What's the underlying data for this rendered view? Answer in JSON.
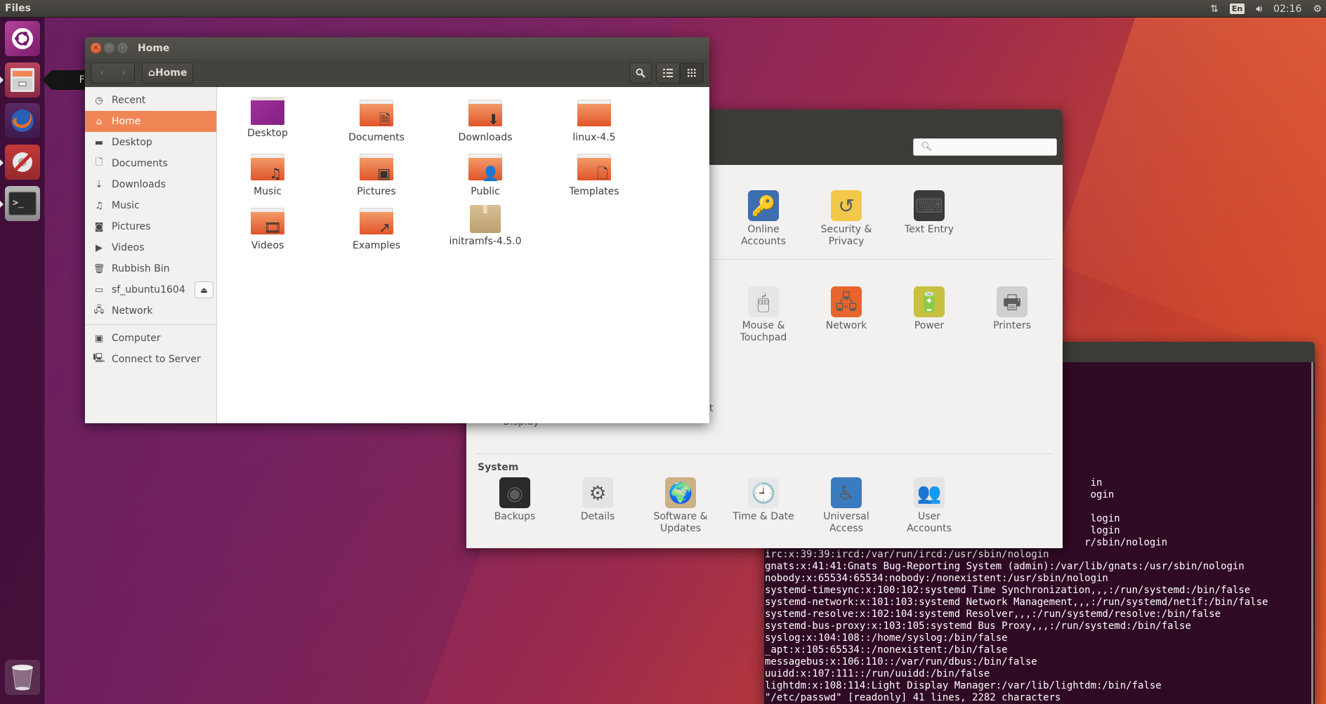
{
  "top_panel": {
    "app_title": "Files",
    "indicators": {
      "network_icon": "network-updown-icon",
      "keyboard_layout": "En",
      "volume_icon": "volume-icon",
      "clock": "02:16",
      "system_icon": "power-gear-icon"
    }
  },
  "launcher": {
    "items": [
      {
        "name": "Search your computer",
        "icon": "ubuntu-dash-icon",
        "running": false
      },
      {
        "name": "Files",
        "icon": "files-drawer-icon",
        "running": true
      },
      {
        "name": "Firefox Web Browser",
        "icon": "firefox-icon",
        "running": false
      },
      {
        "name": "System Settings",
        "icon": "system-settings-icon",
        "running": true
      },
      {
        "name": "Terminal",
        "icon": "terminal-icon",
        "running": true
      }
    ],
    "trash": {
      "icon": "trash-icon"
    },
    "tooltip": "Files"
  },
  "files_window": {
    "title": "Home",
    "toolbar": {
      "back": "‹",
      "forward": "›",
      "path_label": "Home",
      "search_icon": "search-icon",
      "list_view_icon": "list-view-icon",
      "grid_view_icon": "grid-view-icon"
    },
    "sidebar": [
      {
        "label": "Recent",
        "icon": "clock-icon",
        "glyph": "◷",
        "active": false
      },
      {
        "label": "Home",
        "icon": "home-icon",
        "glyph": "⌂",
        "active": true
      },
      {
        "label": "Desktop",
        "icon": "desktop-folder-icon",
        "glyph": "▬",
        "active": false
      },
      {
        "label": "Documents",
        "icon": "document-icon",
        "glyph": "🗋",
        "active": false
      },
      {
        "label": "Downloads",
        "icon": "download-icon",
        "glyph": "⇣",
        "active": false
      },
      {
        "label": "Music",
        "icon": "music-icon",
        "glyph": "♫",
        "active": false
      },
      {
        "label": "Pictures",
        "icon": "camera-icon",
        "glyph": "◙",
        "active": false
      },
      {
        "label": "Videos",
        "icon": "video-icon",
        "glyph": "▶",
        "active": false
      },
      {
        "label": "Rubbish Bin",
        "icon": "trash-icon",
        "glyph": "🗑",
        "active": false
      },
      {
        "label": "sf_ubuntu1604",
        "icon": "drive-icon",
        "glyph": "▭",
        "active": false,
        "eject": "⏏"
      },
      {
        "label": "Network",
        "icon": "network-icon",
        "glyph": "🖧",
        "active": false
      },
      {
        "label": "Computer",
        "icon": "computer-icon",
        "glyph": "▣",
        "active": false
      },
      {
        "label": "Connect to Server",
        "icon": "server-icon",
        "glyph": "🖳",
        "active": false
      }
    ],
    "files": [
      {
        "label": "Desktop",
        "type": "desktop"
      },
      {
        "label": "Documents",
        "type": "folder",
        "emblem": "🗎"
      },
      {
        "label": "Downloads",
        "type": "folder",
        "emblem": "⬇"
      },
      {
        "label": "linux-4.5",
        "type": "folder",
        "emblem": ""
      },
      {
        "label": "Music",
        "type": "folder",
        "emblem": "♫"
      },
      {
        "label": "Pictures",
        "type": "folder",
        "emblem": "▣"
      },
      {
        "label": "Public",
        "type": "folder",
        "emblem": "👤"
      },
      {
        "label": "Templates",
        "type": "folder",
        "emblem": "🗋"
      },
      {
        "label": "Videos",
        "type": "folder",
        "emblem": "🎞"
      },
      {
        "label": "Examples",
        "type": "folder",
        "emblem": "↗"
      },
      {
        "label": "initramfs-4.5.0",
        "type": "archive"
      }
    ]
  },
  "settings_window": {
    "search_placeholder": "",
    "search_icon": "search-icon",
    "personal_row": [
      {
        "label": "Online\nAccounts",
        "icon": "online-accounts-icon",
        "glyph": "🔑",
        "bg": "#3d6fb0"
      },
      {
        "label": "Security &\nPrivacy",
        "icon": "security-privacy-icon",
        "glyph": "↺",
        "bg": "#f2c84a"
      },
      {
        "label": "Text Entry",
        "icon": "text-entry-icon",
        "glyph": "⌨",
        "bg": "#3a3a3a"
      }
    ],
    "hardware_row": [
      {
        "label": "Mouse &\nTouchpad",
        "icon": "mouse-icon",
        "glyph": "🖱",
        "bg": "#e6e6e6"
      },
      {
        "label": "Network",
        "icon": "network-folder-icon",
        "glyph": "🖧",
        "bg": "#e8652e"
      },
      {
        "label": "Power",
        "icon": "power-battery-icon",
        "glyph": "🔋",
        "bg": "#c8c040"
      },
      {
        "label": "Printers",
        "icon": "printer-icon",
        "glyph": "🖶",
        "bg": "#d0d0d0"
      }
    ],
    "partial_label_display": "Display",
    "partial_label_t": "t",
    "system_section": "System",
    "system_row": [
      {
        "label": "Backups",
        "icon": "backups-safe-icon",
        "glyph": "◉",
        "bg": "#2a2a2a"
      },
      {
        "label": "Details",
        "icon": "details-gear-icon",
        "glyph": "⚙",
        "bg": "#e4e4e4"
      },
      {
        "label": "Software &\nUpdates",
        "icon": "software-updates-icon",
        "glyph": "🌍",
        "bg": "#cbb184"
      },
      {
        "label": "Time & Date",
        "icon": "clock-icon",
        "glyph": "🕘",
        "bg": "#e8e8e8"
      },
      {
        "label": "Universal\nAccess",
        "icon": "universal-access-icon",
        "glyph": "♿",
        "bg": "#3b7cc0"
      },
      {
        "label": "User\nAccounts",
        "icon": "user-accounts-icon",
        "glyph": "👥",
        "bg": "#e4e4e4"
      }
    ]
  },
  "terminal": {
    "lines": [
      "                                                       in",
      "                                                       ogin",
      "",
      "                                                       login",
      "                                                       login",
      "                                                      r/sbin/nologin",
      "irc:x:39:39:ircd:/var/run/ircd:/usr/sbin/nologin",
      "gnats:x:41:41:Gnats Bug-Reporting System (admin):/var/lib/gnats:/usr/sbin/nologin",
      "nobody:x:65534:65534:nobody:/nonexistent:/usr/sbin/nologin",
      "systemd-timesync:x:100:102:systemd Time Synchronization,,,:/run/systemd:/bin/false",
      "systemd-network:x:101:103:systemd Network Management,,,:/run/systemd/netif:/bin/false",
      "systemd-resolve:x:102:104:systemd Resolver,,,:/run/systemd/resolve:/bin/false",
      "systemd-bus-proxy:x:103:105:systemd Bus Proxy,,,:/run/systemd:/bin/false",
      "syslog:x:104:108::/home/syslog:/bin/false",
      "_apt:x:105:65534::/nonexistent:/bin/false",
      "messagebus:x:106:110::/var/run/dbus:/bin/false",
      "uuidd:x:107:111::/run/uuidd:/bin/false",
      "lightdm:x:108:114:Light Display Manager:/var/lib/lightdm:/bin/false",
      "\"/etc/passwd\" [readonly] 41 lines, 2282 characters"
    ]
  },
  "colors": {
    "accent": "#f08656",
    "panel": "#3c3b37",
    "terminal_bg": "#2f0a24"
  }
}
